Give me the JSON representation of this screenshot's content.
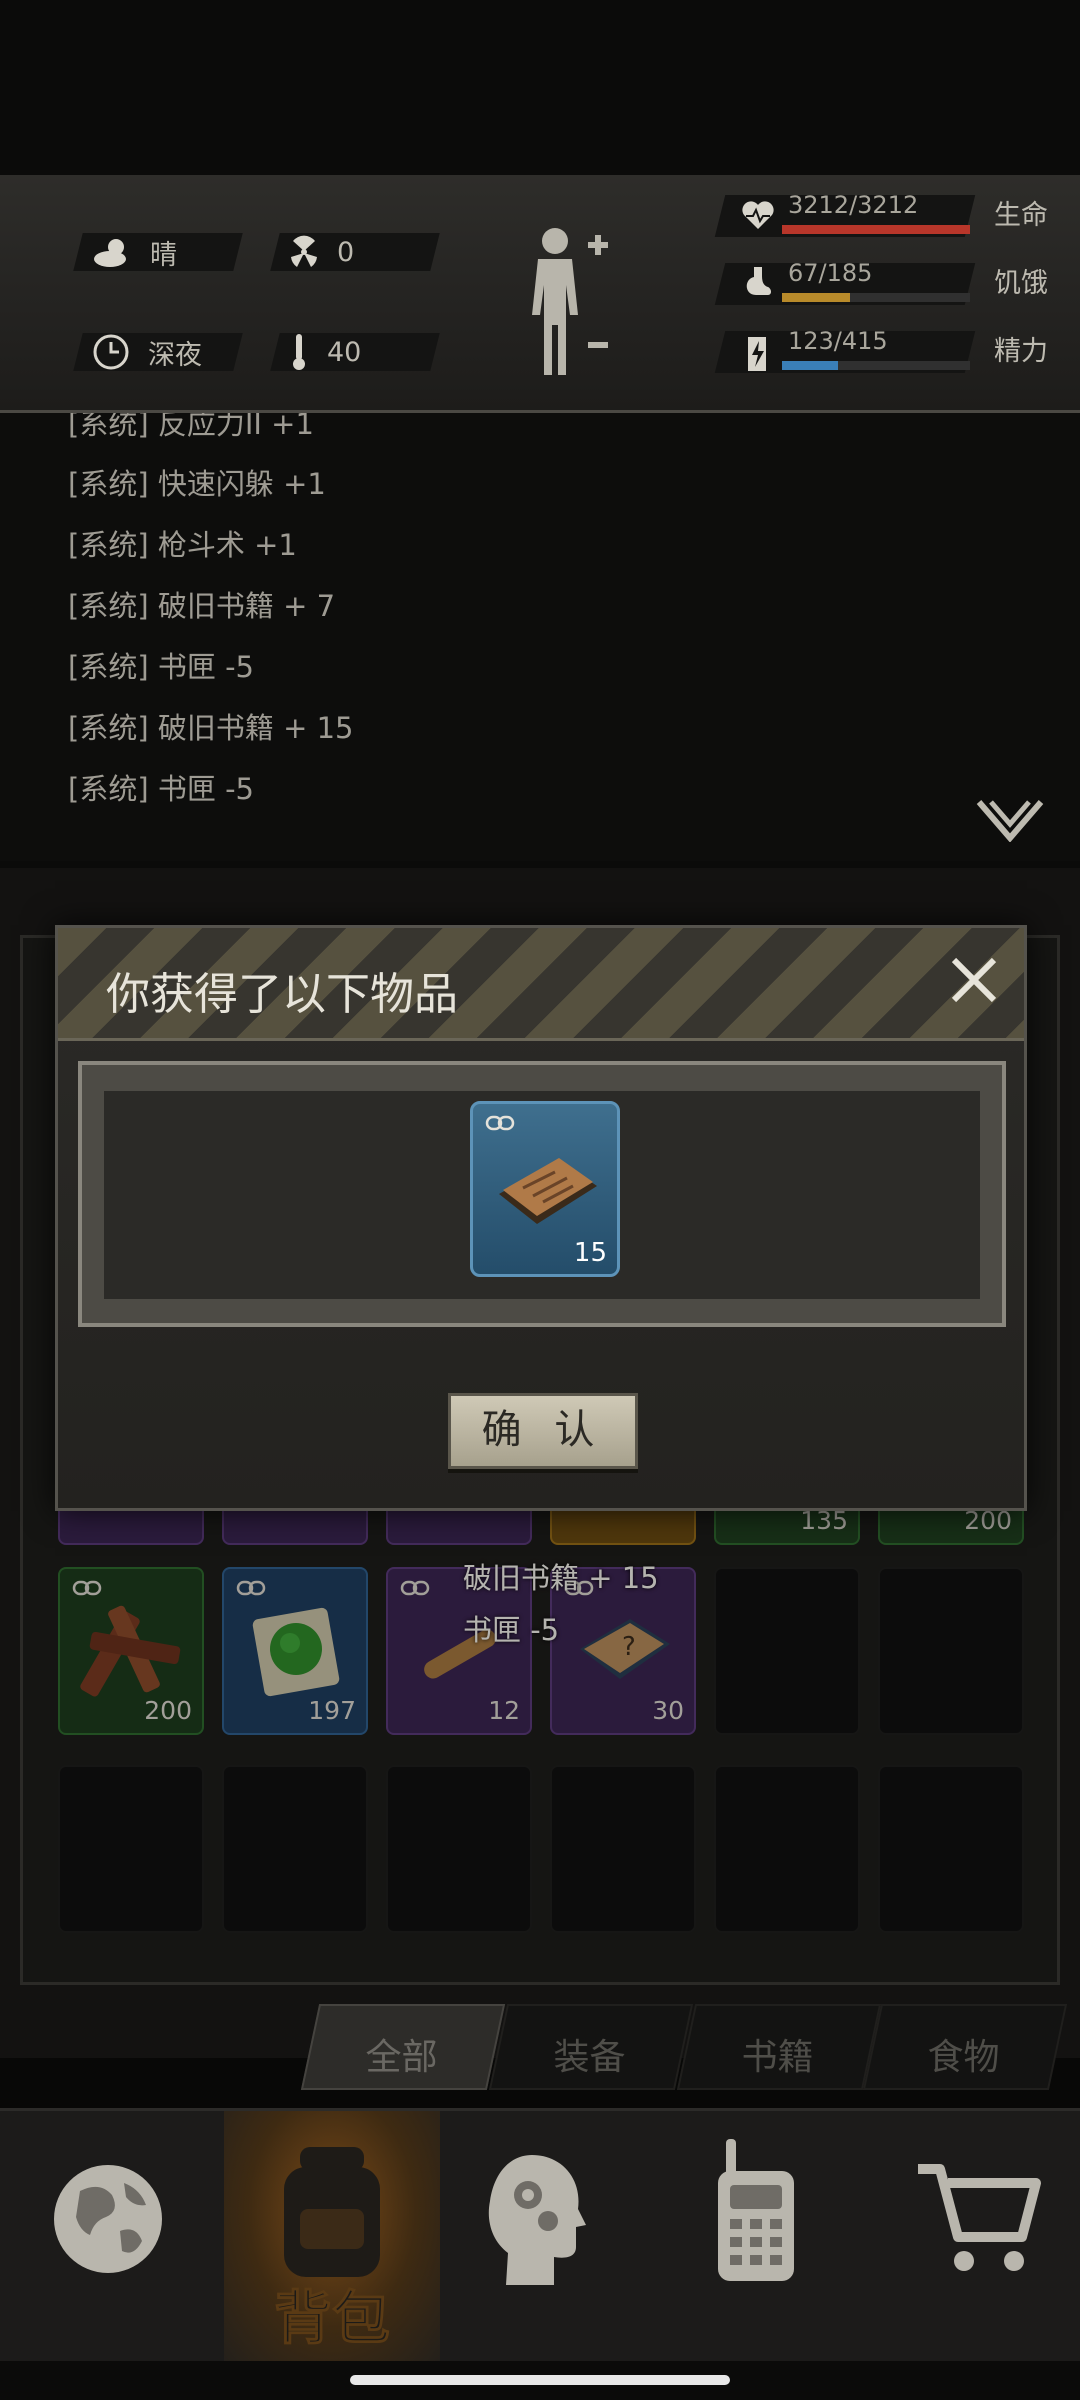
{
  "status": {
    "weather": "晴",
    "radiation": "0",
    "time_of_day": "深夜",
    "temperature": "40",
    "health": {
      "text": "3212/3212",
      "label": "生命",
      "fraction": 1.0,
      "color": "#b8362a"
    },
    "hunger": {
      "text": "67/185",
      "label": "饥饿",
      "fraction": 0.36,
      "color": "#b88a2a"
    },
    "energy": {
      "text": "123/415",
      "label": "精力",
      "fraction": 0.3,
      "color": "#3a7fb8"
    }
  },
  "log": {
    "lines": [
      "[系统] 反应力II +1",
      "[系统] 快速闪躲 +1",
      "[系统] 枪斗术 +1",
      "[系统] 破旧书籍 + 7",
      "[系统] 书匣 -5",
      "[系统] 破旧书籍 + 15",
      "[系统] 书匣 -5"
    ]
  },
  "modal": {
    "title": "你获得了以下物品",
    "item_qty": "15",
    "confirm_label": "确 认"
  },
  "inventory": {
    "partial_row_qty": [
      "135",
      "200"
    ],
    "row": [
      {
        "qty": "200",
        "rarity_color": "#2a5a2a"
      },
      {
        "qty": "197",
        "rarity_color": "#23466b"
      },
      {
        "qty": "12",
        "rarity_color": "#4a2a6a"
      },
      {
        "qty": "30",
        "rarity_color": "#4a2a6a"
      }
    ]
  },
  "notices": [
    "破旧书籍 + 15",
    "书匣 -5"
  ],
  "tabs": [
    "全部",
    "装备",
    "书籍",
    "食物"
  ],
  "nav": {
    "backpack_label": "背包"
  }
}
